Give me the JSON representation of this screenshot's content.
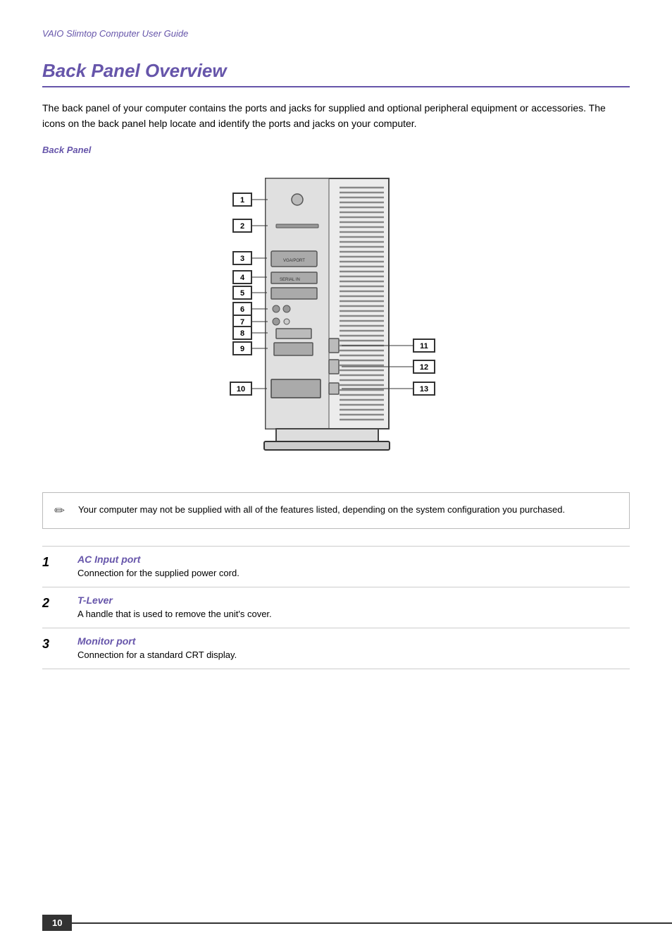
{
  "guide_title": "VAIO Slimtop Computer User Guide",
  "section": {
    "title": "Back Panel Overview",
    "intro": "The back panel of your computer contains the ports and jacks for supplied and optional peripheral equipment or accessories. The icons on the back panel help locate and identify the ports and jacks on your computer.",
    "subsection_label": "Back Panel"
  },
  "note": {
    "text": "Your computer may not be supplied with all of the features listed, depending on the system configuration you purchased."
  },
  "items": [
    {
      "number": "1",
      "name": "AC Input port",
      "description": "Connection for the supplied power cord."
    },
    {
      "number": "2",
      "name": "T-Lever",
      "description": "A handle that is used to remove the unit's cover."
    },
    {
      "number": "3",
      "name": "Monitor port",
      "description": "Connection for a standard CRT display."
    }
  ],
  "page_number": "10",
  "callouts": {
    "left": [
      "1",
      "2",
      "3",
      "4",
      "5",
      "6",
      "7",
      "8",
      "9",
      "10"
    ],
    "right": [
      "11",
      "12",
      "13"
    ]
  }
}
